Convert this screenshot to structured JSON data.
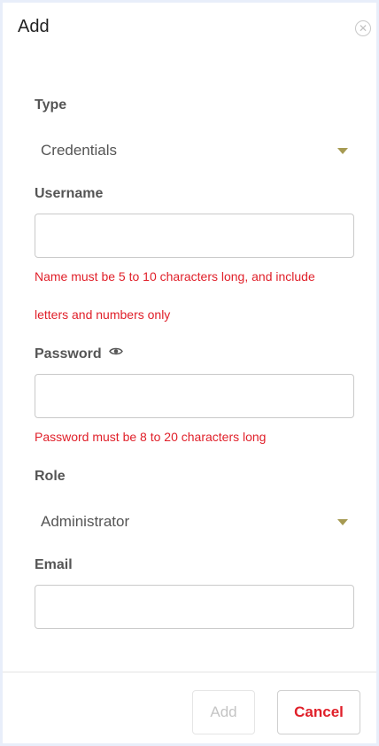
{
  "dialog": {
    "title": "Add",
    "close_icon": "close-circle-icon"
  },
  "form": {
    "type": {
      "label": "Type",
      "value": "Credentials"
    },
    "username": {
      "label": "Username",
      "value": "",
      "error_line1": "Name must be 5 to 10 characters long, and include",
      "error_line2": "letters and numbers only"
    },
    "password": {
      "label": "Password",
      "icon": "eye-icon",
      "value": "",
      "error": "Password must be 8 to 20 characters long"
    },
    "role": {
      "label": "Role",
      "value": "Administrator"
    },
    "email": {
      "label": "Email",
      "value": ""
    }
  },
  "footer": {
    "add_label": "Add",
    "cancel_label": "Cancel"
  },
  "colors": {
    "error": "#e0202a",
    "caret": "#a69a52",
    "disabled": "#c4c4c4"
  }
}
